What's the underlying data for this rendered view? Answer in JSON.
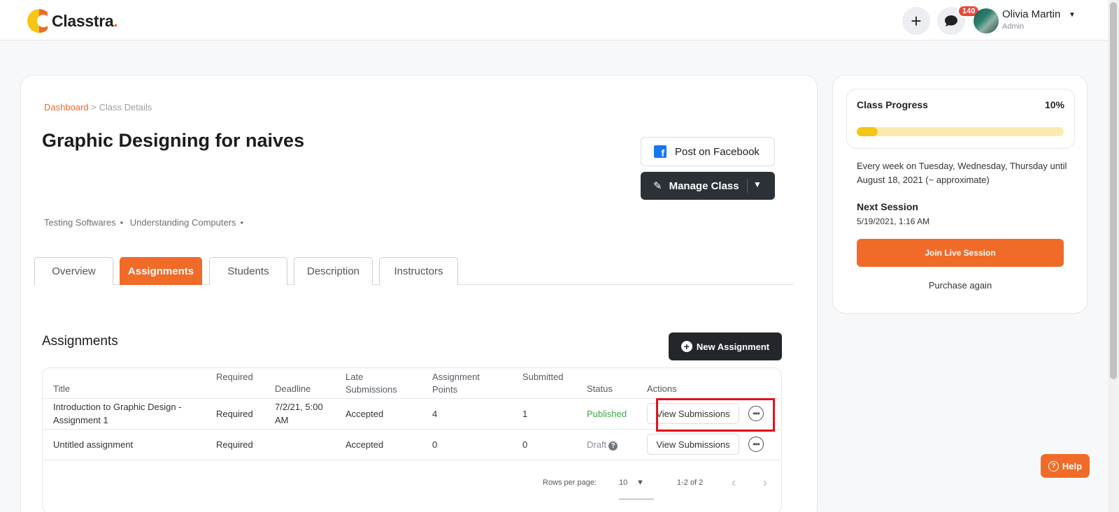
{
  "brand": {
    "name": "Classtra",
    "dot": ".",
    "primary_color": "#f06a28"
  },
  "header": {
    "add_icon": "plus-icon",
    "chat_icon": "chat-bubble-icon",
    "notification_count": "140",
    "user_name": "Olivia Martin",
    "user_role": "Admin"
  },
  "breadcrumb": {
    "home": "Dashboard",
    "separator": ">",
    "current": "Class Details"
  },
  "class": {
    "title": "Graphic Designing for naives",
    "tags": [
      "Testing Softwares",
      "Understanding Computers"
    ],
    "facebook_label": "Post on Facebook",
    "manage_label": "Manage Class"
  },
  "tabs": [
    "Overview",
    "Assignments",
    "Students",
    "Description",
    "Instructors"
  ],
  "active_tab": "Assignments",
  "assignments": {
    "section_title": "Assignments",
    "new_label": "New Assignment",
    "columns": [
      "Title",
      "Required",
      "Deadline",
      "Late Submissions",
      "Assignment Points",
      "Submitted",
      "Status",
      "Actions"
    ],
    "rows": [
      {
        "title": "Introduction to Graphic Design - Assignment 1",
        "required": "Required",
        "deadline": "7/2/21, 5:00 AM",
        "late": "Accepted",
        "points": "4",
        "submitted": "1",
        "status": "Published",
        "action": "View Submissions"
      },
      {
        "title": "Untitled assignment",
        "required": "Required",
        "deadline": "",
        "late": "Accepted",
        "points": "0",
        "submitted": "0",
        "status": "Draft",
        "action": "View Submissions"
      }
    ],
    "pagination": {
      "rows_label": "Rows per page:",
      "rows_value": "10",
      "range": "1-2 of 2"
    }
  },
  "side": {
    "progress_label": "Class Progress",
    "progress_text": "10%",
    "progress_fraction": 0.1,
    "schedule": "Every week on Tuesday, Wednesday, Thursday until August 18, 2021 (~ approximate)",
    "next_label": "Next Session",
    "next_time": "5/19/2021, 1:16 AM",
    "join_label": "Join Live Session",
    "purchase_label": "Purchase again"
  },
  "help_label": "Help"
}
